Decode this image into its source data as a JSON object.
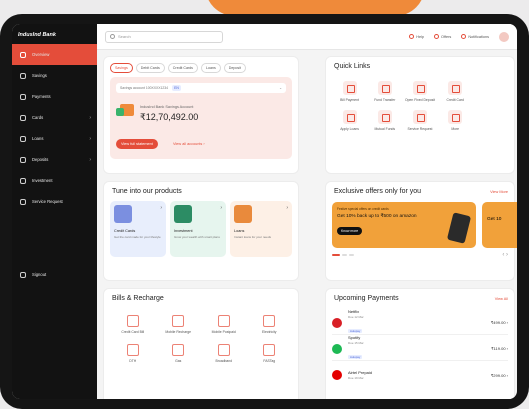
{
  "sidebar": {
    "brand": "IndusInd Bank",
    "items": [
      {
        "label": "Overview",
        "chev": ""
      },
      {
        "label": "Savings",
        "chev": ""
      },
      {
        "label": "Payments",
        "chev": ""
      },
      {
        "label": "Cards",
        "chev": "›"
      },
      {
        "label": "Loans",
        "chev": "›"
      },
      {
        "label": "Deposits",
        "chev": "›"
      },
      {
        "label": "Investment",
        "chev": ""
      },
      {
        "label": "Service Request",
        "chev": ""
      }
    ],
    "signout": "Signout"
  },
  "topbar": {
    "search_placeholder": "Search",
    "links": [
      "Help",
      "Offers",
      "Notifications"
    ],
    "avatar": "EN"
  },
  "accounts": {
    "tabs": [
      "Savings",
      "Debit Cards",
      "Credit Cards",
      "Loans",
      "Deposit"
    ],
    "account_line": "Savings account 100XXXX1234",
    "account_badge": "EN",
    "balance_label": "IndusInd Bank Savings Account",
    "balance": "₹12,70,492.00",
    "primary_button": "View full statement",
    "link": "View all accounts ›"
  },
  "quick_links": {
    "title": "Quick Links",
    "items": [
      "Bill Payment",
      "Fund Transfer",
      "Open Fixed Deposit",
      "Credit Card",
      "Apply Loans",
      "Mutual Funds",
      "Service Request",
      "More"
    ]
  },
  "products": {
    "title": "Tune into our products",
    "items": [
      {
        "title": "Credit Cards",
        "desc": "Get the card made for your lifestyle",
        "bg": "#e8eefc",
        "illus": "#7b8fe0"
      },
      {
        "title": "Investment",
        "desc": "Grow your wealth with smart plans",
        "bg": "#e6f5ee",
        "illus": "#2c8c64"
      },
      {
        "title": "Loans",
        "desc": "Instant loans for your needs",
        "bg": "#fdf0e6",
        "illus": "#e98a3c"
      }
    ]
  },
  "offers": {
    "title": "Exclusive offers only for you",
    "view_all": "View More",
    "card_kicker": "Festive special offers on credit cards",
    "card_title": "Get 10% back up to ₹500 on amazon",
    "card_button": "Know more",
    "card2_title": "Get 10"
  },
  "bills": {
    "title": "Bills & Recharge",
    "items": [
      "Credit Card Bill",
      "Mobile Recharge",
      "Mobile Postpaid",
      "Electricity",
      "DTH",
      "Gas",
      "Broadband",
      "FASTag"
    ]
  },
  "payments": {
    "title": "Upcoming Payments",
    "view_all": "View All",
    "items": [
      {
        "name": "Netflix",
        "sub": "Due 12 Mar",
        "tag": "Autopay",
        "amount": "₹499.00 ›",
        "color": "#d81f26"
      },
      {
        "name": "Spotify",
        "sub": "Due 15 Mar",
        "tag": "Autopay",
        "amount": "₹119.00 ›",
        "color": "#1db954"
      },
      {
        "name": "Airtel Prepaid",
        "sub": "Due 19 Mar",
        "tag": "",
        "amount": "₹299.00 ›",
        "color": "#e40000"
      }
    ]
  }
}
